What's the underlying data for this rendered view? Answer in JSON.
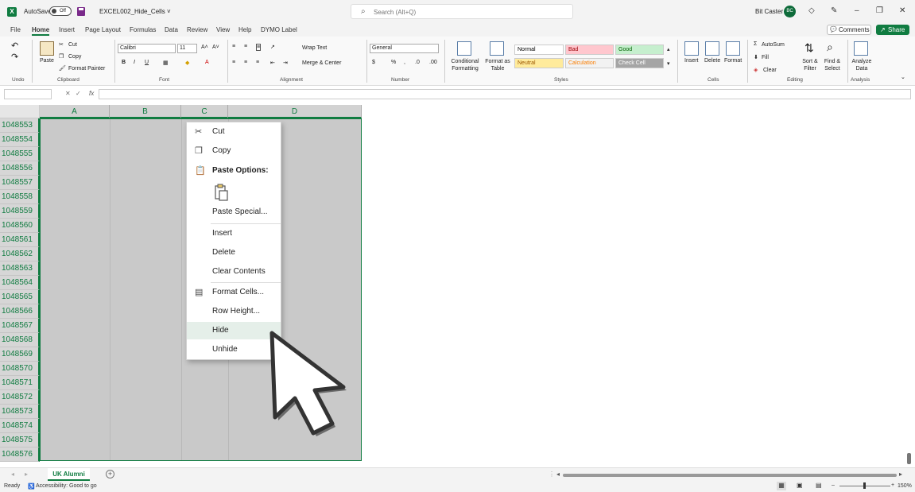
{
  "titlebar": {
    "autosave_label": "AutoSave",
    "autosave_state": "Off",
    "filename": "EXCEL002_Hide_Cells ˅",
    "search_placeholder": "Search (Alt+Q)",
    "user_name": "Bit Caster",
    "user_initials": "BC"
  },
  "menu": {
    "tabs": [
      "File",
      "Home",
      "Insert",
      "Page Layout",
      "Formulas",
      "Data",
      "Review",
      "View",
      "Help",
      "DYMO Label"
    ],
    "active": "Home",
    "comments_label": "Comments",
    "share_label": "Share"
  },
  "ribbon": {
    "groups": [
      "Undo",
      "Clipboard",
      "Font",
      "Alignment",
      "Number",
      "Styles",
      "Cells",
      "Editing",
      "Analysis"
    ],
    "paste_label": "Paste",
    "cut_label": "Cut",
    "copy_label": "Copy",
    "format_painter_label": "Format Painter",
    "font_name": "Calibri",
    "font_size": "11",
    "wrap_text_label": "Wrap Text",
    "merge_center_label": "Merge & Center",
    "number_format": "General",
    "conditional_formatting_label": "Conditional Formatting",
    "format_as_table_label": "Format as Table",
    "styles": [
      {
        "name": "Normal",
        "bg": "#ffffff",
        "color": "#000000"
      },
      {
        "name": "Bad",
        "bg": "#ffc7ce",
        "color": "#9c0006"
      },
      {
        "name": "Good",
        "bg": "#c6efce",
        "color": "#006100"
      },
      {
        "name": "Neutral",
        "bg": "#ffeb9c",
        "color": "#9c5700"
      },
      {
        "name": "Calculation",
        "bg": "#f2f2f2",
        "color": "#fa7d00"
      },
      {
        "name": "Check Cell",
        "bg": "#a5a5a5",
        "color": "#ffffff"
      }
    ],
    "insert_label": "Insert",
    "delete_label": "Delete",
    "format_label": "Format",
    "autosum_label": "AutoSum",
    "fill_label": "Fill",
    "clear_label": "Clear",
    "sort_filter_label": "Sort & Filter",
    "find_select_label": "Find & Select",
    "analyze_data_label": "Analyze Data"
  },
  "formula_bar": {
    "fx_label": "fx",
    "value": ""
  },
  "grid": {
    "columns": [
      "A",
      "B",
      "C",
      "D"
    ],
    "rows": [
      "1048553",
      "1048554",
      "1048555",
      "1048556",
      "1048557",
      "1048558",
      "1048559",
      "1048560",
      "1048561",
      "1048562",
      "1048563",
      "1048564",
      "1048565",
      "1048566",
      "1048567",
      "1048568",
      "1048569",
      "1048570",
      "1048571",
      "1048572",
      "1048573",
      "1048574",
      "1048575",
      "1048576"
    ]
  },
  "context_menu": {
    "cut": "Cut",
    "copy": "Copy",
    "paste_options": "Paste Options:",
    "paste_special": "Paste Special...",
    "insert": "Insert",
    "delete": "Delete",
    "clear_contents": "Clear Contents",
    "format_cells": "Format Cells...",
    "row_height": "Row Height...",
    "hide": "Hide",
    "unhide": "Unhide",
    "highlighted": "Hide"
  },
  "sheets": {
    "tabs": [
      "UK Alumni"
    ],
    "active": "UK Alumni"
  },
  "status": {
    "ready": "Ready",
    "accessibility": "Accessibility: Good to go",
    "zoom": "150%"
  },
  "colors": {
    "accent": "#107c41",
    "selection": "#c9c9c9",
    "hover": "#e5efe9"
  }
}
